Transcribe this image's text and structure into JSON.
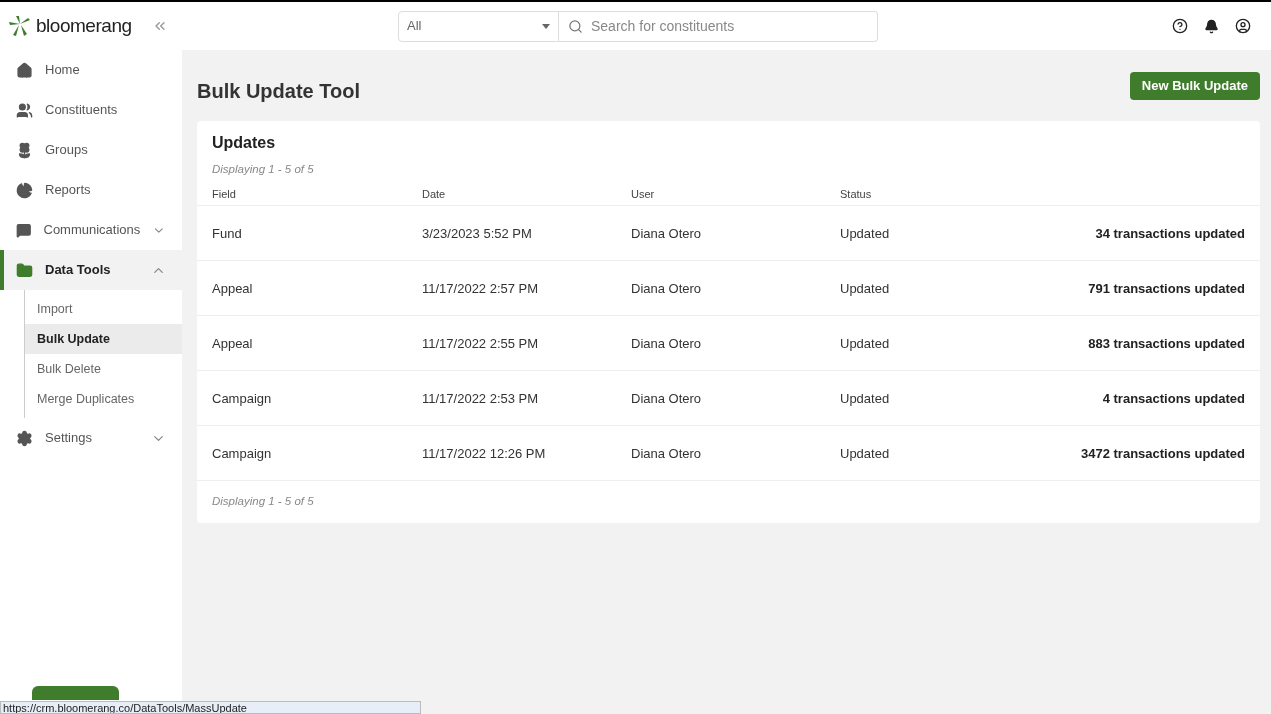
{
  "brand": {
    "name": "bloomerang"
  },
  "search": {
    "scope": "All",
    "placeholder": "Search for constituents"
  },
  "sidebar": {
    "items": [
      {
        "label": "Home",
        "selected": false
      },
      {
        "label": "Constituents",
        "selected": false
      },
      {
        "label": "Groups",
        "selected": false
      },
      {
        "label": "Reports",
        "selected": false
      },
      {
        "label": "Communications",
        "selected": false,
        "expanded": false
      },
      {
        "label": "Data Tools",
        "selected": true,
        "expanded": true,
        "children": [
          {
            "label": "Import",
            "selected": false
          },
          {
            "label": "Bulk Update",
            "selected": true
          },
          {
            "label": "Bulk Delete",
            "selected": false
          },
          {
            "label": "Merge Duplicates",
            "selected": false
          }
        ]
      },
      {
        "label": "Settings",
        "selected": false,
        "expanded": false
      }
    ]
  },
  "page": {
    "title": "Bulk Update Tool",
    "action": "New Bulk Update"
  },
  "table": {
    "title": "Updates",
    "summary_top": "Displaying 1 - 5 of 5",
    "summary_bottom": "Displaying 1 - 5 of 5",
    "columns": [
      "Field",
      "Date",
      "User",
      "Status"
    ],
    "rows": [
      {
        "field": "Fund",
        "date": "3/23/2023 5:52 PM",
        "user": "Diana Otero",
        "status": "Updated",
        "result": "34 transactions updated"
      },
      {
        "field": "Appeal",
        "date": "11/17/2022 2:57 PM",
        "user": "Diana Otero",
        "status": "Updated",
        "result": "791 transactions updated"
      },
      {
        "field": "Appeal",
        "date": "11/17/2022 2:55 PM",
        "user": "Diana Otero",
        "status": "Updated",
        "result": "883 transactions updated"
      },
      {
        "field": "Campaign",
        "date": "11/17/2022 2:53 PM",
        "user": "Diana Otero",
        "status": "Updated",
        "result": "4 transactions updated"
      },
      {
        "field": "Campaign",
        "date": "11/17/2022 12:26 PM",
        "user": "Diana Otero",
        "status": "Updated",
        "result": "3472 transactions updated"
      }
    ]
  },
  "status_bar": {
    "url": "https://crm.bloomerang.co/DataTools/MassUpdate"
  }
}
